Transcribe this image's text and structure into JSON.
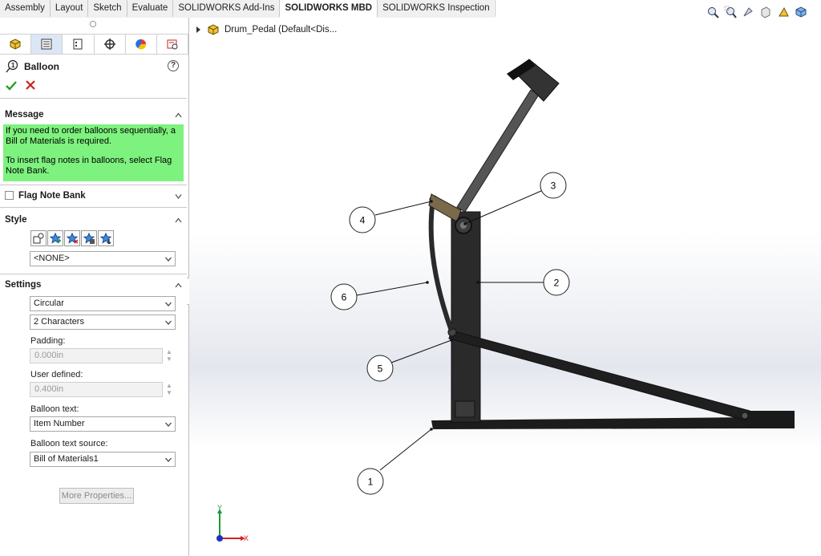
{
  "tabs": [
    "Assembly",
    "Layout",
    "Sketch",
    "Evaluate",
    "SOLIDWORKS Add-Ins",
    "SOLIDWORKS MBD",
    "SOLIDWORKS Inspection"
  ],
  "active_tab": "SOLIDWORKS MBD",
  "panel_icon_tabs": [
    "feature-manager-icon",
    "property-manager-icon",
    "configuration-manager-icon",
    "dimxpert-icon",
    "display-manager-icon",
    "mbd-manager-icon"
  ],
  "property_manager": {
    "title": "Balloon",
    "help": "?",
    "message_section": {
      "header": "Message",
      "line1": "If you need to order balloons sequentially, a Bill of Materials is required.",
      "line2": "To insert flag notes in balloons, select Flag Note Bank."
    },
    "flag_note_bank": {
      "label": "Flag Note Bank",
      "checked": false
    },
    "style_section": {
      "header": "Style",
      "style_value": "<NONE>"
    },
    "settings_section": {
      "header": "Settings",
      "shape": "Circular",
      "size": "2 Characters",
      "padding_label": "Padding:",
      "padding_value": "0.000in",
      "user_defined_label": "User defined:",
      "user_defined_value": "0.400in",
      "balloon_text_label": "Balloon text:",
      "balloon_text_value": "Item Number",
      "balloon_text_source_label": "Balloon text source:",
      "balloon_text_source_value": "Bill of Materials1",
      "more_button": "More Properties..."
    }
  },
  "tree": {
    "label": "Drum_Pedal  (Default<Dis..."
  },
  "balloons": [
    "1",
    "2",
    "3",
    "4",
    "5",
    "6"
  ],
  "triad": {
    "y": "Y",
    "x": "X"
  },
  "colors": {
    "message_bg": "#7ef27e",
    "accept": "#2a9d2a",
    "reject": "#d02020",
    "triad_x": "#d42020",
    "triad_y": "#1a9a3a",
    "triad_z": "#2030c0"
  }
}
